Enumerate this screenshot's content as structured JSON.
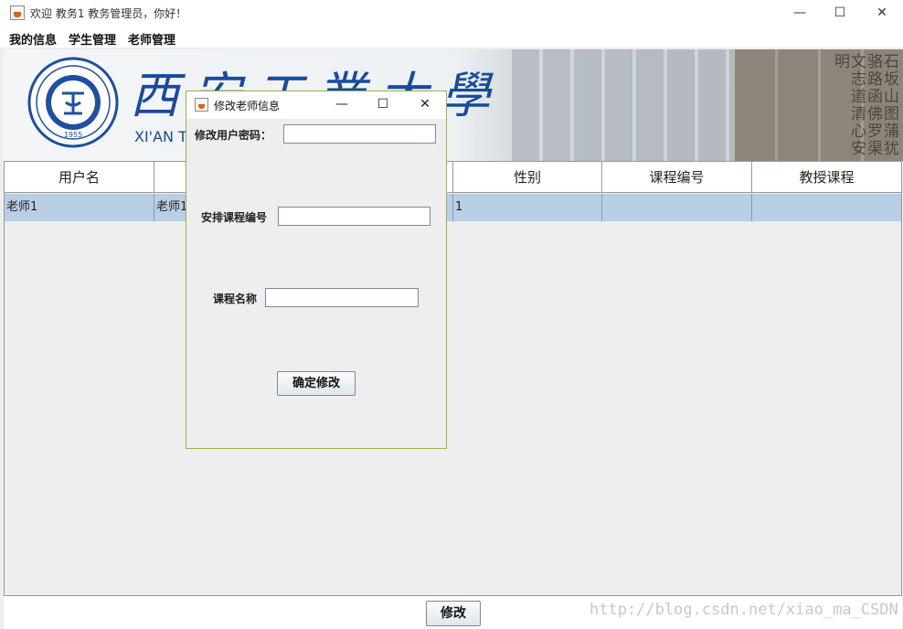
{
  "window": {
    "title": "欢迎 教务1 教务管理员，你好！",
    "minimize_glyph": "—",
    "maximize_glyph": "☐",
    "close_glyph": "✕"
  },
  "menu": {
    "items": [
      "我的信息",
      "学生管理",
      "老师管理"
    ]
  },
  "banner": {
    "calligraphy": "西安工業大學",
    "english": "XI'AN T",
    "seal_year": "1955",
    "stone_text": "石坂山图蒲犹骆路函佛罗渠文志道清心安明"
  },
  "table": {
    "columns": [
      "用户名",
      "",
      "",
      "性别",
      "课程编号",
      "教授课程"
    ],
    "rows": [
      [
        "老师1",
        "老师1",
        "",
        "1",
        "",
        ""
      ]
    ]
  },
  "dialog": {
    "title": "修改老师信息",
    "password_label": "修改用户密码：",
    "password_value": "",
    "course_id_label": "安排课程编号",
    "course_id_value": "",
    "course_name_label": "课程名称",
    "course_name_value": "",
    "confirm_label": "确定修改"
  },
  "bottom": {
    "modify_label": "修改"
  },
  "watermark": "http://blog.csdn.net/xiao_ma_CSDN",
  "colors": {
    "selected_row": "#b8cfe5",
    "brand_blue": "#1a4a9a",
    "dialog_border": "#97b24a"
  }
}
